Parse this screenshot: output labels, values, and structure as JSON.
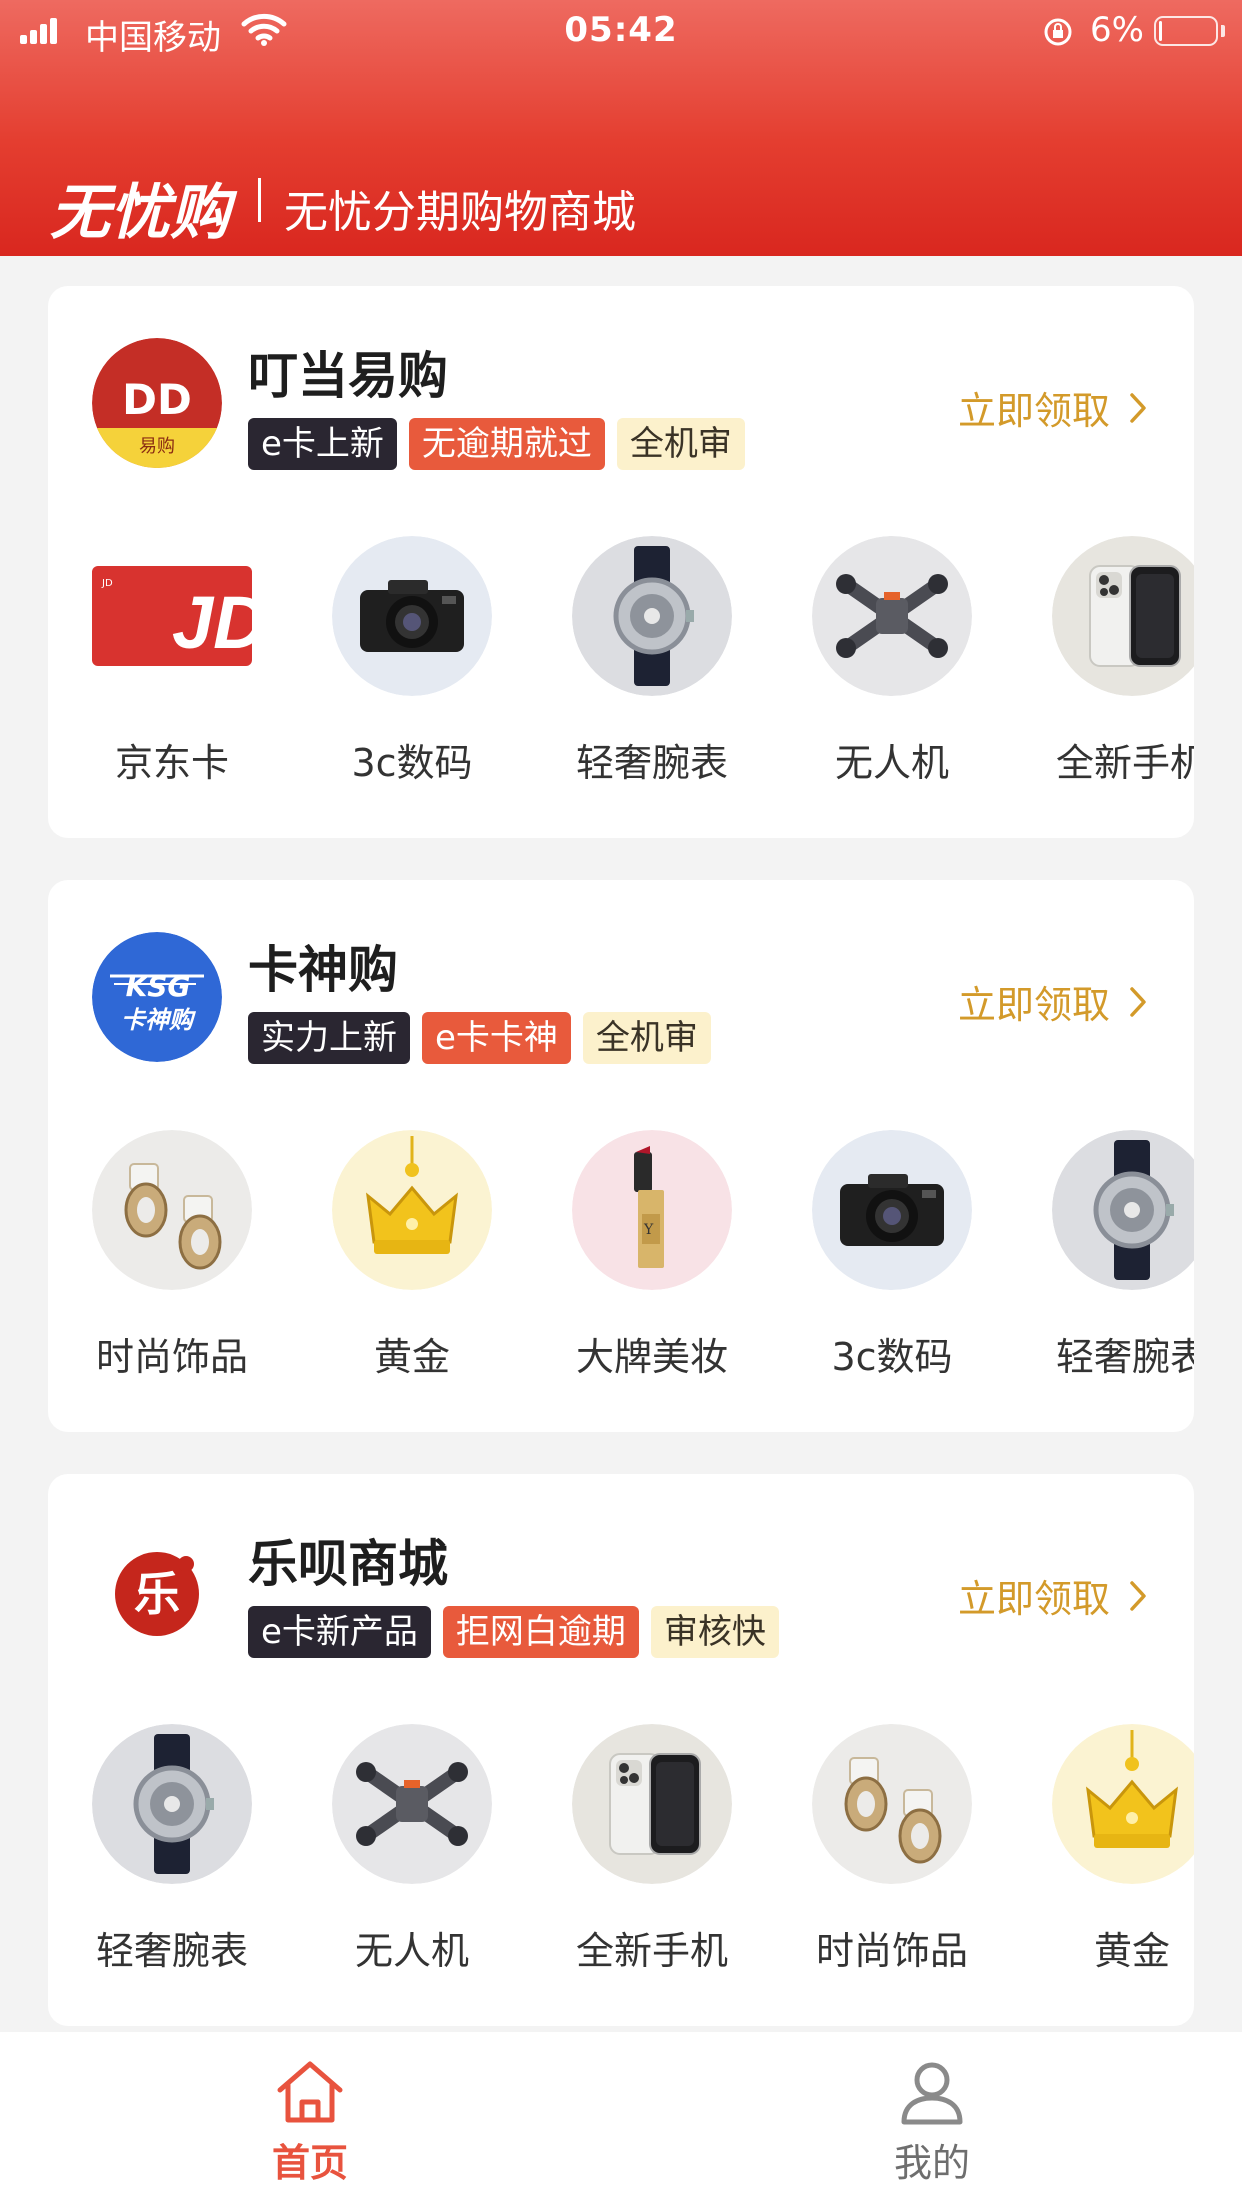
{
  "status_bar": {
    "carrier": "中国移动",
    "time": "05:42",
    "battery": "6%",
    "battery_level": 0.06,
    "icons": [
      "signal-icon",
      "wifi-icon",
      "orientation-lock-icon",
      "battery-icon"
    ]
  },
  "header": {
    "brand": "无忧购",
    "subtitle": "无忧分期购物商城"
  },
  "colors": {
    "header_red": "#e43e30",
    "claim_gold": "#d39a2a",
    "tag_dark": "#2a2631",
    "tag_red": "#e85a3c",
    "tag_cream": "#fcf1cc",
    "tab_active": "#e8533e",
    "tab_inactive": "#8a8a8a"
  },
  "shops": [
    {
      "name": "叮当易购",
      "logo": "dingdang-logo",
      "logo_text": "易购",
      "tags": [
        {
          "label": "e卡上新",
          "style": "dark"
        },
        {
          "label": "无逾期就过",
          "style": "red"
        },
        {
          "label": "全机审",
          "style": "cream"
        }
      ],
      "claim": "立即领取",
      "products": [
        {
          "label": "京东卡",
          "image": "jd-card"
        },
        {
          "label": "3c数码",
          "image": "camera"
        },
        {
          "label": "轻奢腕表",
          "image": "watch"
        },
        {
          "label": "无人机",
          "image": "drone"
        },
        {
          "label": "全新手机",
          "image": "phone"
        }
      ]
    },
    {
      "name": "卡神购",
      "logo": "kashen-logo",
      "logo_text": "卡神购",
      "tags": [
        {
          "label": "实力上新",
          "style": "dark"
        },
        {
          "label": "e卡卡神",
          "style": "red"
        },
        {
          "label": "全机审",
          "style": "cream"
        }
      ],
      "claim": "立即领取",
      "products": [
        {
          "label": "时尚饰品",
          "image": "earrings"
        },
        {
          "label": "黄金",
          "image": "gold-crown"
        },
        {
          "label": "大牌美妆",
          "image": "lipstick"
        },
        {
          "label": "3c数码",
          "image": "camera"
        },
        {
          "label": "轻奢腕表",
          "image": "watch"
        }
      ]
    },
    {
      "name": "乐呗商城",
      "logo": "lebei-logo",
      "logo_text": "乐",
      "tags": [
        {
          "label": "e卡新产品",
          "style": "dark"
        },
        {
          "label": "拒网白逾期",
          "style": "red"
        },
        {
          "label": "审核快",
          "style": "cream"
        }
      ],
      "claim": "立即领取",
      "products": [
        {
          "label": "轻奢腕表",
          "image": "watch"
        },
        {
          "label": "无人机",
          "image": "drone"
        },
        {
          "label": "全新手机",
          "image": "phone"
        },
        {
          "label": "时尚饰品",
          "image": "earrings"
        },
        {
          "label": "黄金",
          "image": "gold-crown"
        }
      ]
    }
  ],
  "tabbar": [
    {
      "label": "首页",
      "icon": "home-icon",
      "active": true
    },
    {
      "label": "我的",
      "icon": "user-icon",
      "active": false
    }
  ]
}
